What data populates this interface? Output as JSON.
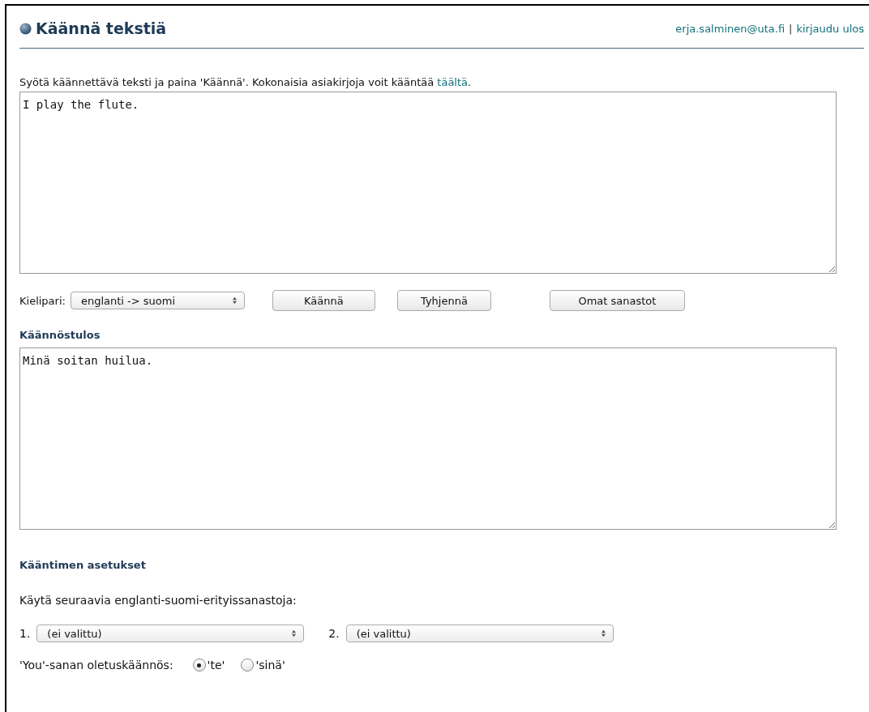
{
  "header": {
    "title": "Käännä tekstiä",
    "user": "erja.salminen@uta.fi",
    "separator": "|",
    "logout": "kirjaudu ulos"
  },
  "intro": {
    "text": "Syötä käännettävä teksti ja paina 'Käännä'. Kokonaisia asiakirjoja voit kääntää ",
    "link": "täältä",
    "end": "."
  },
  "source": {
    "value": "I play the flute."
  },
  "controls": {
    "label": "Kielipari:",
    "language_pair": "englanti -> suomi",
    "buttons": [
      "Käännä",
      "Tyhjennä",
      "Omat sanastot"
    ]
  },
  "result": {
    "heading": "Käännöstulos",
    "value": "Minä soitan huilua."
  },
  "settings": {
    "heading": "Kääntimen asetukset",
    "text": "Käytä seuraavia englanti-suomi-erityissanastoja:",
    "vocabularies": [
      {
        "number": "1.",
        "value": "(ei valittu)"
      },
      {
        "number": "2.",
        "value": "(ei valittu)"
      }
    ],
    "you_label": "'You'-sanan oletuskäännös:",
    "you_options": [
      {
        "label": "'te'",
        "selected": true
      },
      {
        "label": "'sinä'",
        "selected": false
      }
    ]
  }
}
